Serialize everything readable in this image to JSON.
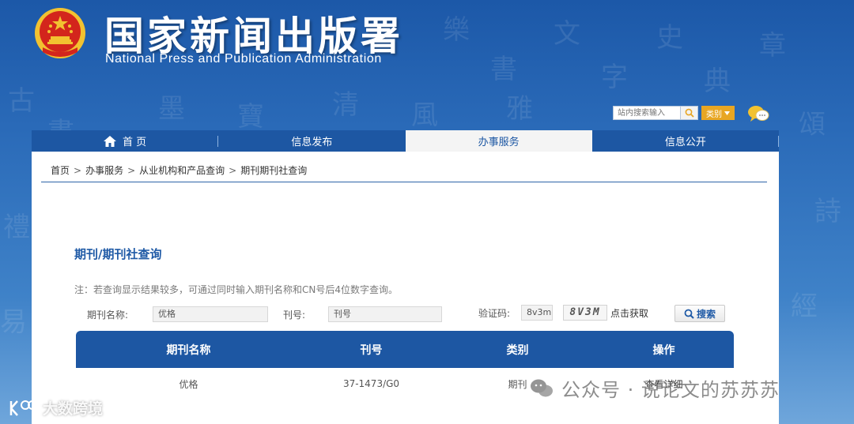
{
  "header": {
    "title_cn": "国家新闻出版署",
    "title_en": "National Press and Publication Administration"
  },
  "site_search": {
    "placeholder": "站内搜索输入",
    "category_label": "类别"
  },
  "nav": {
    "items": [
      {
        "label": "首 页"
      },
      {
        "label": "信息发布"
      },
      {
        "label": "办事服务"
      },
      {
        "label": "信息公开"
      }
    ]
  },
  "breadcrumb": {
    "items": [
      "首页",
      "办事服务",
      "从业机构和产品查询",
      "期刊期刊社查询"
    ],
    "separator": ">"
  },
  "page": {
    "title": "期刊/期刊社查询",
    "note": "注：若查询显示结果较多，可通过同时输入期刊名称和CN号后4位数字查询。"
  },
  "form": {
    "name_label": "期刊名称:",
    "name_value": "优格",
    "cn_label": "刊号:",
    "cn_value": "刊号",
    "captcha_label": "验证码:",
    "captcha_value": "8v3m",
    "captcha_image_text": "8V3M",
    "refresh_label": "点击获取",
    "search_label": "搜索"
  },
  "table": {
    "headers": [
      "期刊名称",
      "刊号",
      "类别",
      "操作"
    ],
    "rows": [
      {
        "name": "优格",
        "cn": "37-1473/G0",
        "type": "期刊",
        "action": "查看详细"
      }
    ]
  },
  "watermarks": {
    "right": "公众号 · 说论文的苏苏苏",
    "left": "大数跨境"
  },
  "colors": {
    "brand_blue": "#1d57a3",
    "title_blue": "#1f5aa6",
    "accent_orange": "#e8a623",
    "emblem_red": "#d3251c",
    "emblem_gold": "#f2c230"
  }
}
